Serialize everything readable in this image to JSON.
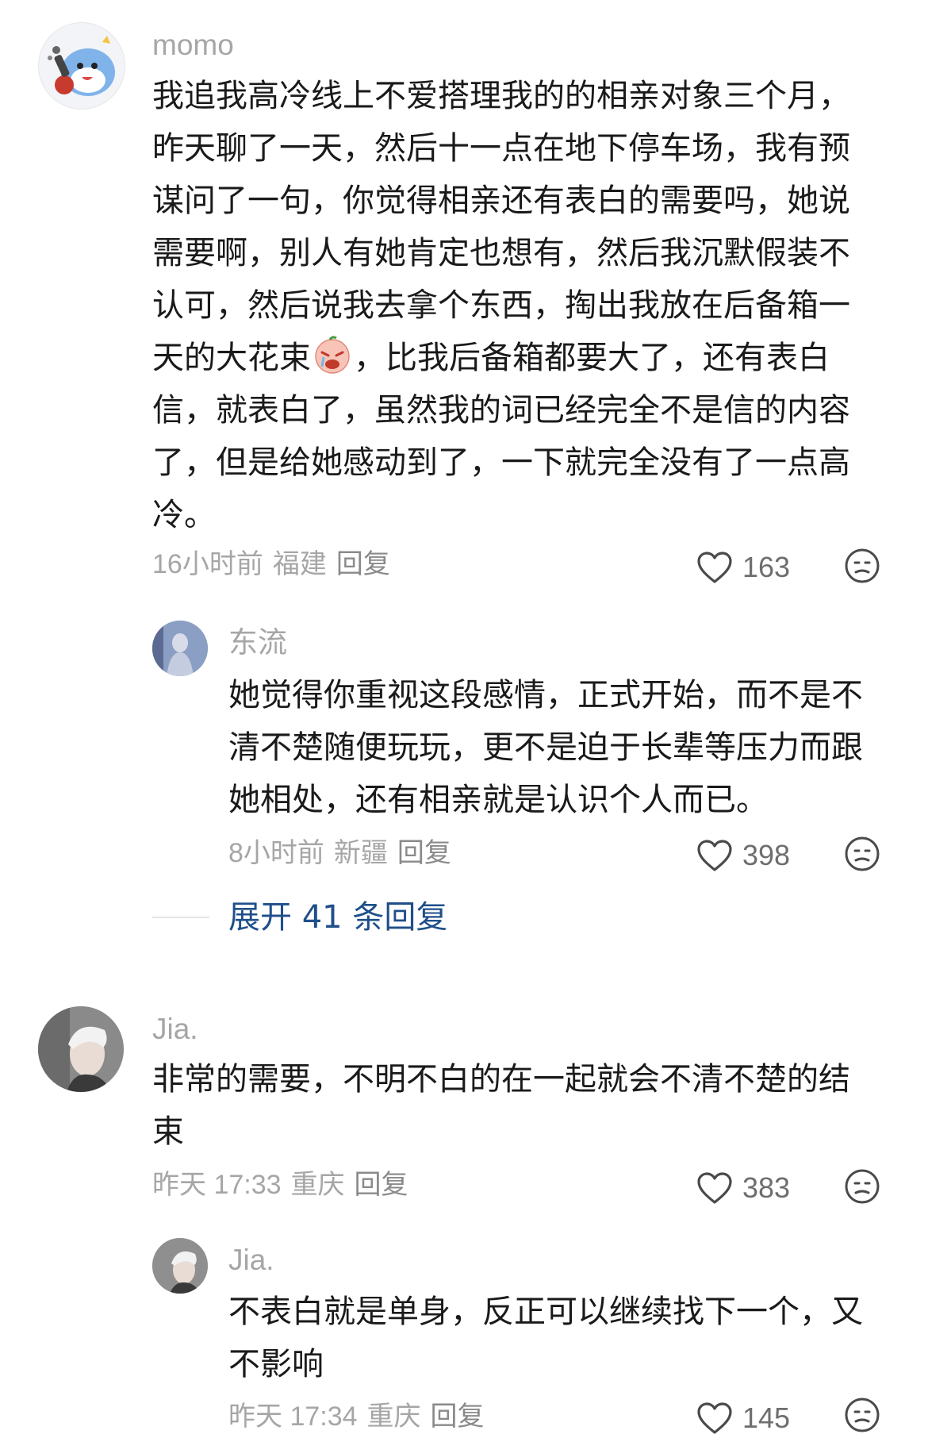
{
  "comments": [
    {
      "username": "momo",
      "content_part1": "我追我高冷线上不爱搭理我的的相亲对象三个月，昨天聊了一天，然后十一点在地下停车场，我有预谋问了一句，你觉得相亲还有表白的需要吗，她说需要啊，别人有她肯定也想有，然后我沉默假装不认可，然后说我去拿个东西，掏出我放在后备箱一天的大花束",
      "content_part2": "，比我后备箱都要大了，还有表白信，就表白了，虽然我的词已经完全不是信的内容了，但是给她感动到了，一下就完全没有了一点高冷。",
      "time": "16小时前",
      "location": "福建",
      "reply_label": "回复",
      "likes": "163",
      "reply": {
        "username": "东流",
        "content": "她觉得你重视这段感情，正式开始，而不是不清不楚随便玩玩，更不是迫于长辈等压力而跟她相处，还有相亲就是认识个人而已。",
        "time": "8小时前",
        "location": "新疆",
        "reply_label": "回复",
        "likes": "398"
      },
      "expand_label": "展开 41 条回复"
    },
    {
      "username": "Jia.",
      "content": "非常的需要，不明不白的在一起就会不清不楚的结束",
      "time": "昨天 17:33",
      "location": "重庆",
      "reply_label": "回复",
      "likes": "383",
      "reply": {
        "username": "Jia.",
        "content": "不表白就是单身，反正可以继续找下一个，又不影响",
        "time": "昨天 17:34",
        "location": "重庆",
        "reply_label": "回复",
        "likes": "145"
      }
    }
  ],
  "icons": {
    "like": "heart-outline-icon",
    "dislike": "unhappy-face-icon",
    "inline_emoji": "crying-face-emoji"
  },
  "colors": {
    "username": "#a6a6a6",
    "text": "#1a1a1a",
    "meta": "#a6a6a6",
    "expand_link": "#1f4f8a"
  }
}
